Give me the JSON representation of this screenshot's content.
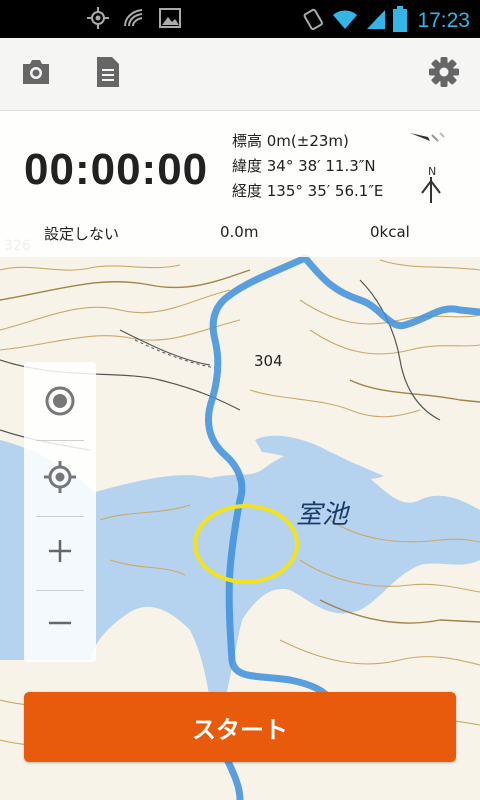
{
  "status_bar": {
    "time": "17:23",
    "left_icons": [
      "gps-icon",
      "wifi-signal-icon",
      "image-icon"
    ],
    "right_icons": [
      "vibrate-icon",
      "wifi-icon",
      "cell-signal-icon",
      "battery-icon"
    ],
    "time_color": "#33b5e5"
  },
  "toolbar": {
    "icons": [
      "camera-icon",
      "document-icon",
      "gear-icon"
    ]
  },
  "info": {
    "timer": "00:00:00",
    "altitude": "標高 0m(±23m)",
    "latitude": "緯度 34° 38′ 11.3″N",
    "longitude": "経度 135° 35′ 56.1″E",
    "compass_label": "N",
    "goal": "設定しない",
    "distance": "0.0m",
    "calories": "0kcal"
  },
  "map": {
    "pond_name": "室池",
    "elevation_label": "304",
    "contour_label": "326",
    "water_color": "#b5d3ee",
    "route_color": "#3d8fdc",
    "marker_color": "#f2e31c"
  },
  "controls": {
    "icons": [
      "my-location-icon",
      "gps-target-icon",
      "zoom-in-icon",
      "zoom-out-icon"
    ]
  },
  "start_button": {
    "label": "スタート",
    "color": "#e85a0c"
  }
}
